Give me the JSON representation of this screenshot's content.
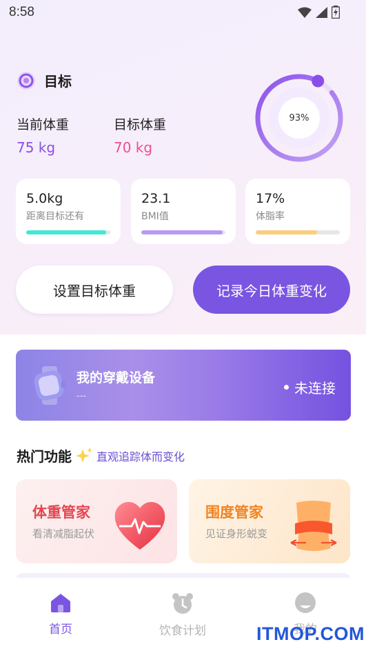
{
  "status_bar": {
    "time": "8:58"
  },
  "goal": {
    "title": "目标",
    "current_label": "当前体重",
    "current_value": "75 kg",
    "target_label": "目标体重",
    "target_value": "70 kg",
    "progress_text": "93%",
    "progress": 0.93
  },
  "stats": [
    {
      "value": "5.0kg",
      "label": "距离目标还有",
      "fill": 0.95,
      "color": "#3fe9d5"
    },
    {
      "value": "23.1",
      "label": "BMI值",
      "fill": 0.97,
      "color": "#b69af3"
    },
    {
      "value": "17%",
      "label": "体脂率",
      "fill": 0.73,
      "color": "#fbcd7d"
    }
  ],
  "buttons": {
    "set_goal": "设置目标体重",
    "record_today": "记录今日体重变化"
  },
  "device": {
    "title": "我的穿戴设备",
    "subtitle": "---",
    "status": "未连接"
  },
  "hot": {
    "title": "热门功能",
    "subtitle": "直观追踪体而变化",
    "cards": [
      {
        "title": "体重管家",
        "subtitle": "看清减脂起伏"
      },
      {
        "title": "围度管家",
        "subtitle": "见证身形蜕变"
      }
    ]
  },
  "tabs": [
    {
      "label": "首页",
      "active": true
    },
    {
      "label": "饮食计划",
      "active": false
    },
    {
      "label": "我的",
      "active": false
    }
  ],
  "watermark": "ITMOP.COM",
  "colors": {
    "accent": "#7a55e2",
    "current": "#8a4ee8",
    "target": "#ef4f8f"
  }
}
